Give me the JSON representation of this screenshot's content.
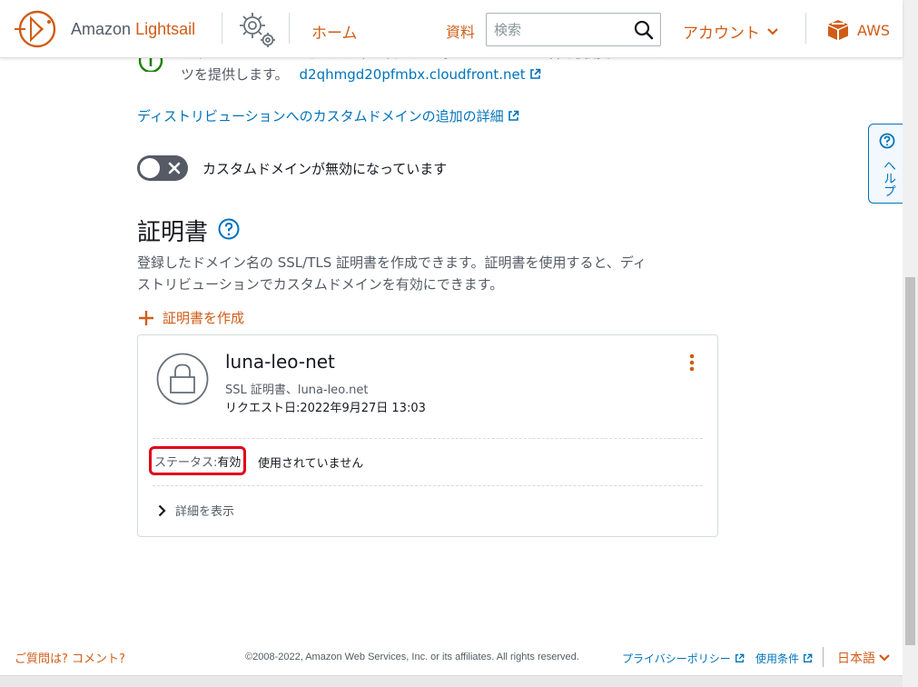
{
  "header": {
    "logo_prefix": "Amazon",
    "logo_brand": "Lightsail",
    "nav_home": "ホーム",
    "nav_docs": "資料",
    "search_placeholder": "検索",
    "account": "アカウント",
    "aws": "AWS"
  },
  "help_tab": {
    "label": "ヘルプ"
  },
  "distribution": {
    "info_line1": "ディストリビューションは、常に次のデフォルトのドメイン名を使用してコンテン",
    "info_line2": "ツを提供します。",
    "default_domain": "d2qhmgd20pfmbx.cloudfront.net",
    "custom_domain_details_link": "ディストリビューションへのカスタムドメインの追加の詳細",
    "custom_domain_toggle_label": "カスタムドメインが無効になっています",
    "custom_domain_enabled": false
  },
  "certificates": {
    "heading": "証明書",
    "description_line1": "登録したドメイン名の SSL/TLS 証明書を作成できます。証明書を使用すると、ディ",
    "description_line2": "ストリビューションでカスタムドメインを有効にできます。",
    "create_label": "証明書を作成",
    "items": [
      {
        "name": "luna-leo-net",
        "subtitle": "SSL 証明書、luna-leo.net",
        "request_date": "リクエスト日:2022年9月27日 13:03",
        "status_label": "ステータス:",
        "status_value": "有効",
        "usage": "使用されていません",
        "details_toggle": "詳細を表示"
      }
    ]
  },
  "footer": {
    "feedback": "ご質問は? コメント?",
    "copyright": "©2008-2022, Amazon Web Services, Inc. or its affiliates. All rights reserved.",
    "privacy": "プライバシーポリシー",
    "terms": "使用条件",
    "language": "日本語"
  },
  "colors": {
    "accent_orange": "#d05c17",
    "link_blue": "#0073bb",
    "status_highlight": "#e0001a",
    "info_green": "#1d8102"
  }
}
